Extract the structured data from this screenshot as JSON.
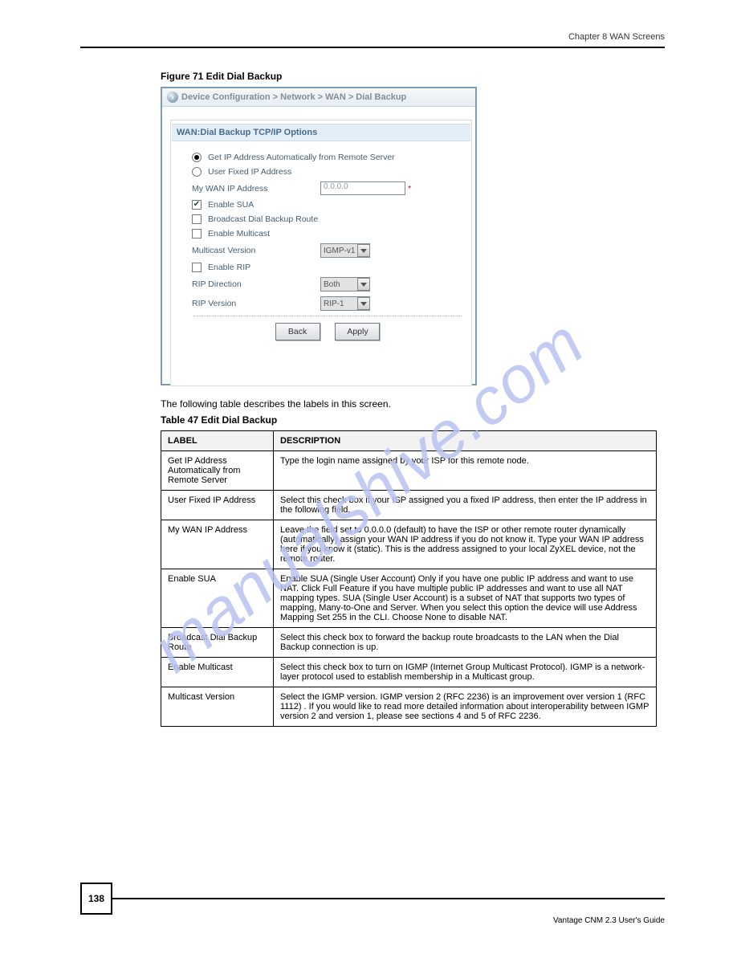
{
  "header": {
    "chapter": "Chapter 8 WAN Screens"
  },
  "figure": {
    "caption": "Figure 71   Edit Dial Backup",
    "breadcrumb": "Device Configuration > Network > WAN > Dial Backup",
    "breadcrumb_arrow_glyph": "›",
    "panel_title": "WAN:Dial Backup TCP/IP Options",
    "form": {
      "radio_auto": "Get IP Address Automatically from Remote Server",
      "radio_fixed": "User Fixed IP Address",
      "my_wan_ip_label": "My WAN IP Address",
      "my_wan_ip_value": "0.0.0.0",
      "enable_sua": "Enable SUA",
      "broadcast": "Broadcast Dial Backup Route",
      "enable_multicast": "Enable Multicast",
      "multicast_version_label": "Multicast Version",
      "multicast_version_value": "IGMP-v1",
      "enable_rip": "Enable RIP",
      "rip_direction_label": "RIP Direction",
      "rip_direction_value": "Both",
      "rip_version_label": "RIP Version",
      "rip_version_value": "RIP-1",
      "btn_back": "Back",
      "btn_apply": "Apply"
    }
  },
  "description": "The following table describes the labels in this screen.",
  "table_caption": "Table 47   Edit Dial Backup",
  "table": {
    "header": {
      "label": "LABEL",
      "desc": "DESCRIPTION"
    },
    "rows": [
      {
        "label": "Get IP Address Automatically from Remote Server",
        "desc": "Type the login name assigned by your ISP for this remote node."
      },
      {
        "label": "User Fixed IP Address",
        "desc": "Select this check box if your ISP assigned you a fixed IP address, then enter the IP address in the following field."
      },
      {
        "label": "My WAN IP Address",
        "desc": "Leave the field set to 0.0.0.0 (default) to have the ISP or other remote router dynamically (automatically) assign your WAN IP address if you do not know it. Type your WAN IP address here if you know it (static). This is the address assigned to your local ZyXEL device, not the remote router."
      },
      {
        "label": "Enable SUA",
        "desc": "Enable SUA (Single User Account) Only if you have one public IP address and want to use NAT. Click Full Feature if you have multiple public IP addresses and want to use all NAT mapping types. SUA (Single User Account) is a subset of NAT that supports two types of mapping, Many-to-One and Server. When you select this option the device will use Address Mapping Set 255 in the CLI. Choose None to disable NAT."
      },
      {
        "label": "Broadcast Dial Backup Route",
        "desc": "Select this check box to forward the backup route broadcasts to the LAN when the Dial Backup connection is up."
      },
      {
        "label": "Enable Multicast",
        "desc": "Select this check box to turn on IGMP (Internet Group Multicast Protocol). IGMP is a network-layer protocol used to establish membership in a Multicast group."
      },
      {
        "label": "Multicast Version",
        "desc": "Select the IGMP version. IGMP version 2 (RFC 2236) is an improvement over version 1 (RFC 1112) . If you would like to read more detailed information about interoperability between IGMP version 2 and version 1, please see sections 4 and 5 of RFC 2236."
      }
    ]
  },
  "footer": {
    "page_number": "138",
    "guide": "Vantage CNM 2.3 User's Guide"
  },
  "watermark": "manualshive.com"
}
